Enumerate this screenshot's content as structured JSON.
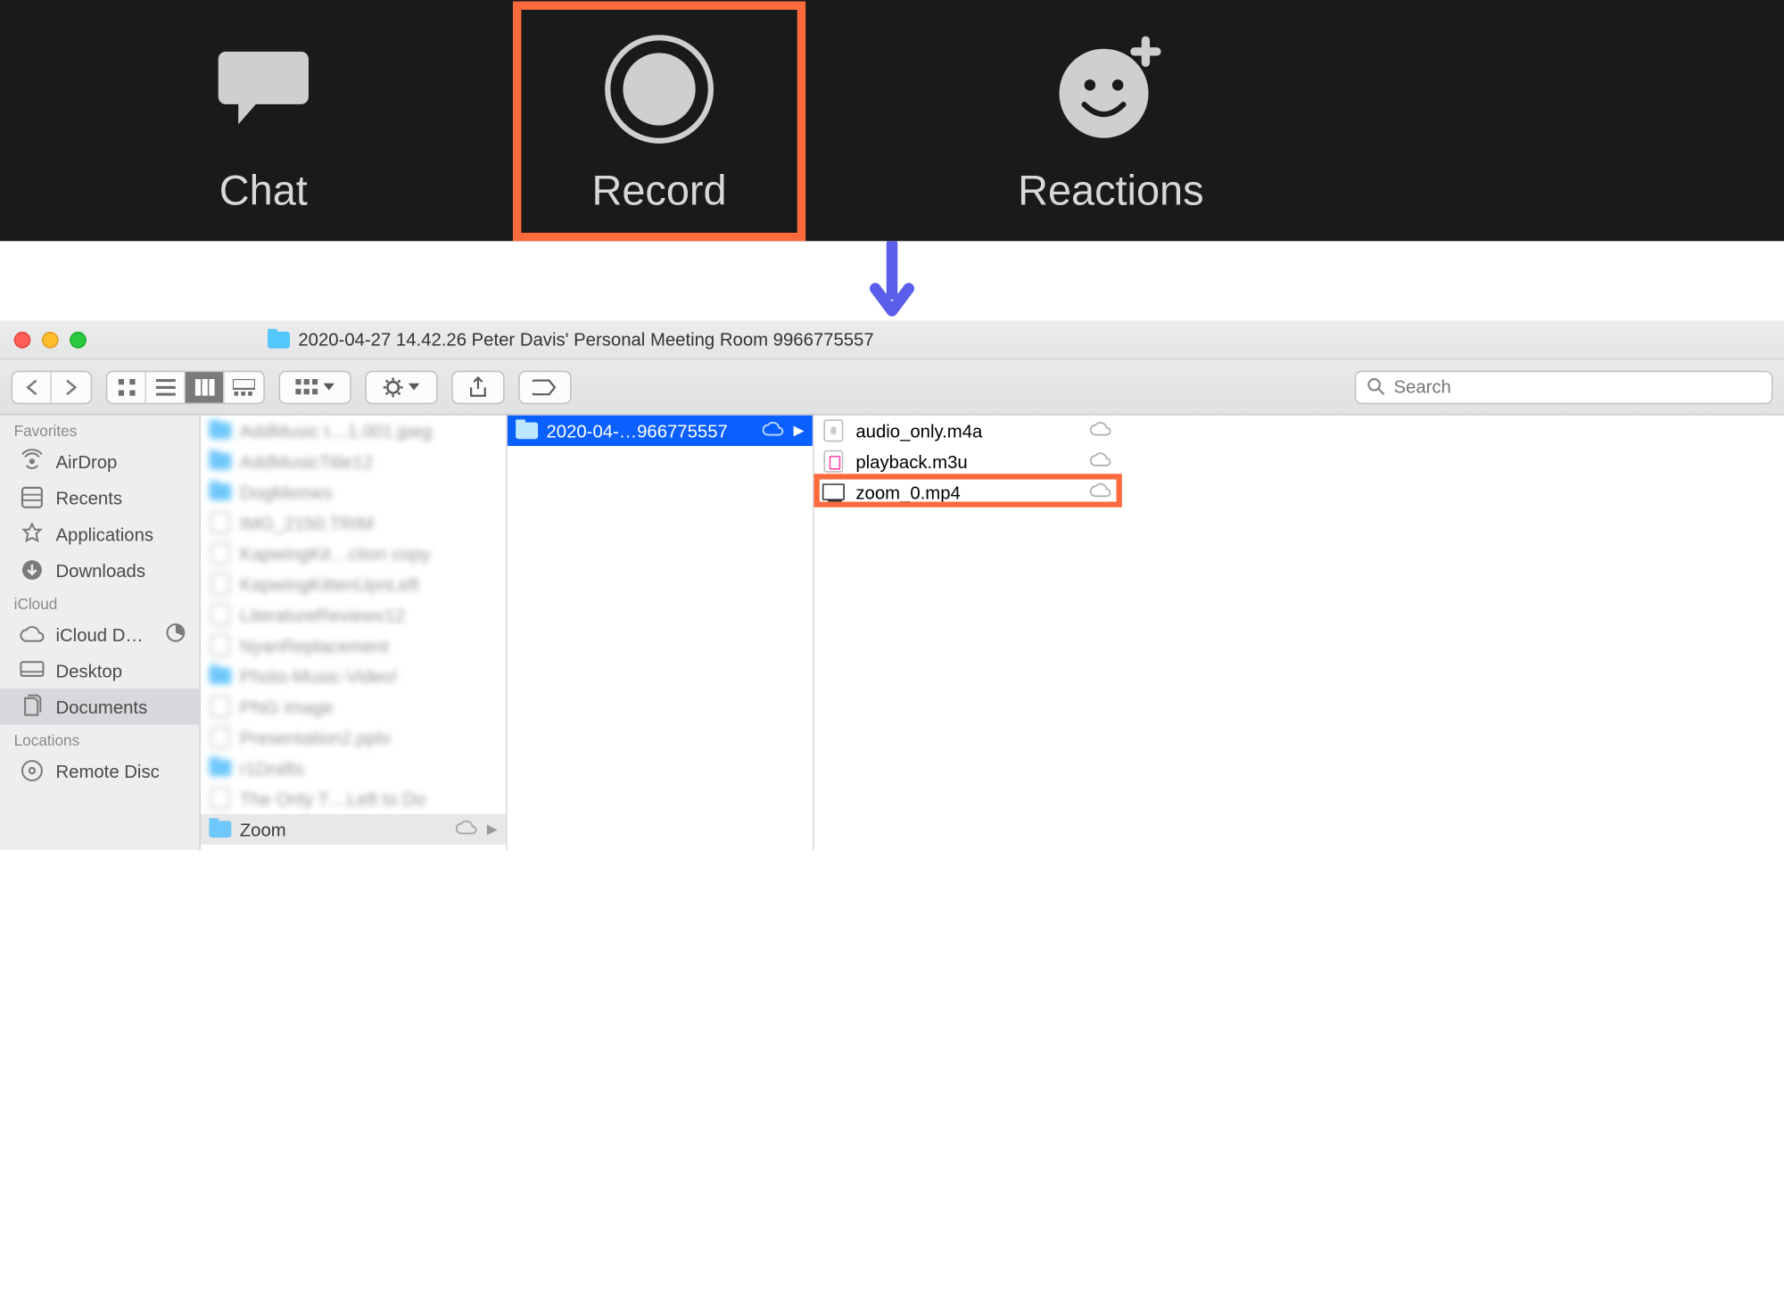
{
  "zoom_toolbar": {
    "chat_label": "Chat",
    "record_label": "Record",
    "reactions_label": "Reactions"
  },
  "finder": {
    "title": "2020-04-27 14.42.26 Peter Davis' Personal Meeting Room 9966775557",
    "search_placeholder": "Search",
    "sidebar": {
      "favorites_header": "Favorites",
      "favorites": [
        {
          "label": "AirDrop"
        },
        {
          "label": "Recents"
        },
        {
          "label": "Applications"
        },
        {
          "label": "Downloads"
        }
      ],
      "icloud_header": "iCloud",
      "icloud": [
        {
          "label": "iCloud D…"
        },
        {
          "label": "Desktop"
        },
        {
          "label": "Documents",
          "selected": true
        }
      ],
      "locations_header": "Locations",
      "locations": [
        {
          "label": "Remote Disc"
        }
      ]
    },
    "column1": {
      "blurred_items": [
        "AddMusic t…1.001.jpeg",
        "AddMusicTitle12",
        "DogMemes",
        "IMG_2150.TRIM",
        "KapwingKit…ction copy",
        "KapwingKittenUpnLeft",
        "LiteratureReviewv12",
        "NyanReplacement",
        "Photo-Music-Video!",
        "PNG image",
        "Presentation2.pptx",
        "r1Drafts",
        "The Only T…Left to Do"
      ],
      "zoom_folder_label": "Zoom"
    },
    "column2": {
      "selected_folder": "2020-04-…966775557"
    },
    "column3": {
      "files": [
        {
          "name": "audio_only.m4a",
          "type": "audio"
        },
        {
          "name": "playback.m3u",
          "type": "music"
        },
        {
          "name": "zoom_0.mp4",
          "type": "video",
          "highlighted": true
        }
      ]
    }
  }
}
